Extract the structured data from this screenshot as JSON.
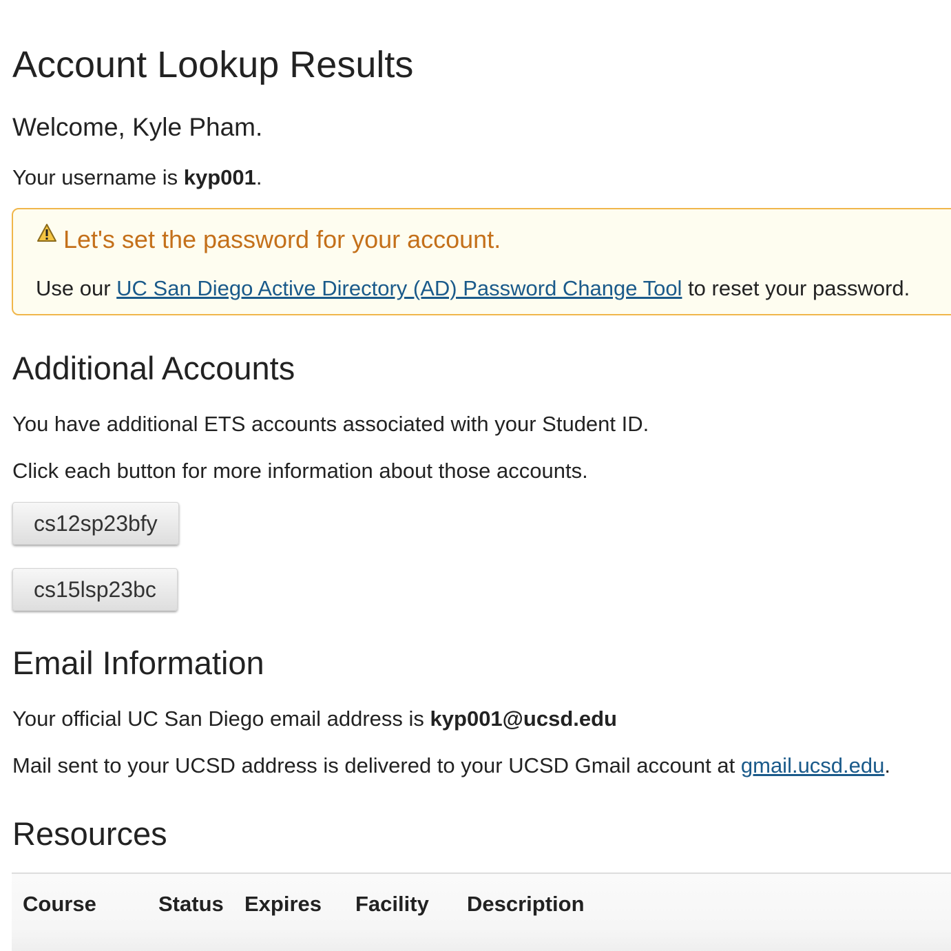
{
  "page": {
    "title": "Account Lookup Results",
    "welcome": "Welcome, Kyle Pham.",
    "username_prefix": "Your username is ",
    "username": "kyp001",
    "username_suffix": "."
  },
  "alert": {
    "icon": "warning-icon",
    "title": "Let's set the password for your account.",
    "body_prefix": "Use our ",
    "link_text": "UC San Diego Active Directory (AD) Password Change Tool",
    "body_suffix": " to reset your password."
  },
  "additional": {
    "heading": "Additional Accounts",
    "line1": "You have additional ETS accounts associated with your Student ID.",
    "line2": "Click each button for more information about those accounts.",
    "accounts": [
      "cs12sp23bfy",
      "cs15lsp23bc"
    ]
  },
  "email": {
    "heading": "Email Information",
    "line1_prefix": "Your official UC San Diego email address is ",
    "address": "kyp001@ucsd.edu",
    "line2_prefix": "Mail sent to your UCSD address is delivered to your UCSD Gmail account at ",
    "gmail_link": "gmail.ucsd.edu",
    "line2_suffix": "."
  },
  "resources": {
    "heading": "Resources",
    "columns": [
      "Course",
      "Status",
      "Expires",
      "Facility",
      "Description"
    ]
  },
  "colors": {
    "alert_border": "#f0b64a",
    "alert_bg": "#fefdf0",
    "alert_title": "#c4701a",
    "link": "#1a5a8a"
  }
}
